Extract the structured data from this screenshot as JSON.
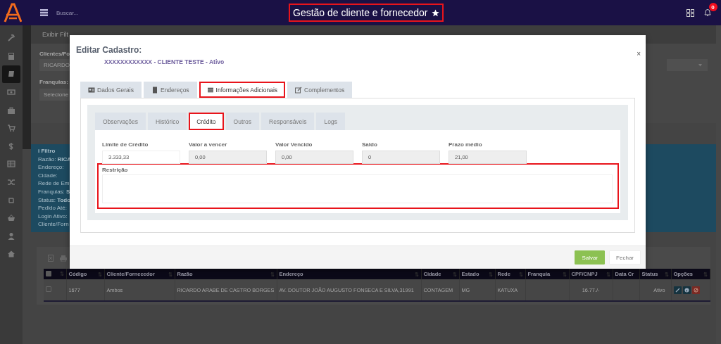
{
  "top_bar": {
    "search_placeholder": "Buscar...",
    "page_title": "Gestão de cliente e fornecedor",
    "title_highlighted": true,
    "favorite": true,
    "notification_count": "0"
  },
  "sidebar": {
    "items": [
      {
        "selected": false
      },
      {
        "selected": false
      },
      {
        "selected": true
      },
      {
        "selected": false
      },
      {
        "selected": false
      },
      {
        "selected": false
      },
      {
        "selected": false
      },
      {
        "selected": false
      },
      {
        "selected": false
      },
      {
        "selected": false
      },
      {
        "selected": false
      },
      {
        "selected": false
      },
      {
        "selected": false
      }
    ]
  },
  "background": {
    "filter_toggle": "Exibir Filt",
    "client_label": "Clientes/Fo",
    "client_value": "RICARDO",
    "franchise_label": "Franquias:",
    "franchise_placeholder": "Selecione",
    "filter_summary": {
      "title": "i Filtro",
      "lines": [
        "Razão: **RICA**",
        "Endereço:",
        "Cidade:",
        "Rede de Em",
        "Franquias: **S**",
        "Status: **Todo**",
        "Pedido Até:",
        "Login Ativo:",
        "Cliente/Forn"
      ]
    },
    "table": {
      "columns": [
        "Código",
        "Cliente/Fornecedor",
        "Razão",
        "Endereço",
        "Cidade",
        "Estado",
        "Rede",
        "Franquia",
        "CPF/CNPJ",
        "Data Cr",
        "Status",
        "Opções"
      ],
      "rows": [
        {
          "checked": false,
          "cells": [
            "1677",
            "Ambos",
            "RICARDO ARABE DE CASTRO BORGES",
            "AV. DOUTOR JOÃO AUGUSTO FONSECA E SILVA,31991",
            "CONTAGEM",
            "MG",
            "KATUXA",
            null,
            "16.77./-",
            null,
            "Ativo"
          ]
        }
      ]
    }
  },
  "modal": {
    "title": "Editar Cadastro:",
    "subtitle": "XXXXXXXXXXXX - CLIENTE TESTE - Ativo",
    "close": "×",
    "tabs": [
      {
        "label": "Dados Gerais",
        "selected": false,
        "highlighted": false
      },
      {
        "label": "Endereços",
        "selected": false,
        "highlighted": false
      },
      {
        "label": "Informações Adicionais",
        "selected": true,
        "highlighted": true
      },
      {
        "label": "Complementos",
        "selected": false,
        "highlighted": false
      }
    ],
    "subtabs": [
      {
        "label": "Observações",
        "selected": false,
        "highlighted": false
      },
      {
        "label": "Histórico",
        "selected": false,
        "highlighted": false
      },
      {
        "label": "Crédito",
        "selected": true,
        "highlighted": true
      },
      {
        "label": "Outros",
        "selected": false,
        "highlighted": false
      },
      {
        "label": "Responsáveis",
        "selected": false,
        "highlighted": false
      },
      {
        "label": "Logs",
        "selected": false,
        "highlighted": false
      }
    ],
    "fields": [
      {
        "label": "Limite de Crédito",
        "value": "3.333,33",
        "disabled": false
      },
      {
        "label": "Valor a vencer",
        "value": "0,00",
        "disabled": true
      },
      {
        "label": "Valor Vencido",
        "value": "0,00",
        "disabled": true
      },
      {
        "label": "Saldo",
        "value": "0",
        "disabled": true
      },
      {
        "label": "Prazo médio",
        "value": "21,00",
        "disabled": true
      }
    ],
    "restriction": {
      "label": "Restrição",
      "highlighted": true
    },
    "buttons": [
      {
        "label": "Salvar",
        "kind": "primary"
      },
      {
        "label": "Fechar",
        "kind": "default"
      }
    ]
  }
}
